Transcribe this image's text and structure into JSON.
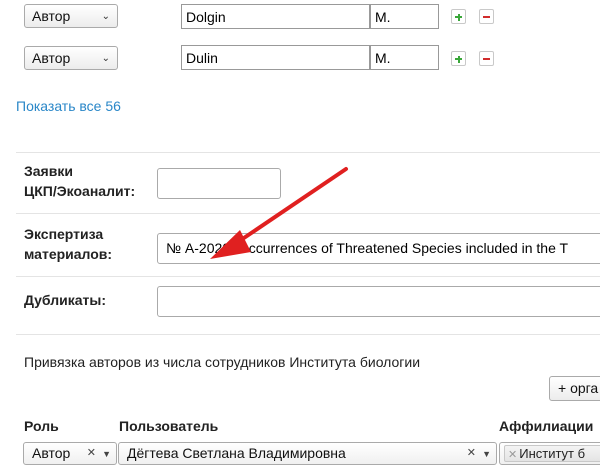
{
  "authors": [
    {
      "role": "Автор",
      "surname": "Dolgin",
      "initials": "M."
    },
    {
      "role": "Автор",
      "surname": "Dulin",
      "initials": "M."
    }
  ],
  "show_all_link": "Показать все 56",
  "fields": {
    "ckp_label_1": "Заявки",
    "ckp_label_2": "ЦКП/Экоаналит:",
    "ckp_value": "",
    "expertise_label_1": "Экспертиза",
    "expertise_label_2": "материалов:",
    "expertise_value": "№ А-2020. Occurrences of Threatened Species included in the T",
    "duplicates_label": "Дубликаты:",
    "duplicates_value": ""
  },
  "binding": {
    "text": "Привязка авторов из числа сотрудников Института биологии",
    "add_org_button": "+ орга",
    "columns": {
      "role": "Роль",
      "user": "Пользователь",
      "affiliation": "Аффилиации"
    },
    "rows": [
      {
        "role": "Автор",
        "user": "Дёгтева Светлана Владимировна",
        "affiliation_tag": "Институт б"
      }
    ]
  },
  "colors": {
    "link": "#2a87c8",
    "annotation_arrow": "#e02020",
    "add_icon": "#3aa73a",
    "remove_icon": "#d12c2c"
  }
}
